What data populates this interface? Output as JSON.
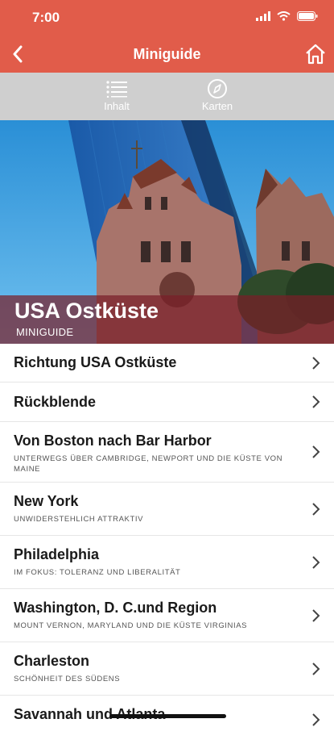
{
  "status": {
    "time": "7:00"
  },
  "nav": {
    "title": "Miniguide"
  },
  "toolbar": {
    "items": [
      {
        "label": "Inhalt",
        "icon": "list-icon"
      },
      {
        "label": "Karten",
        "icon": "compass-icon"
      }
    ]
  },
  "hero": {
    "title": "USA Ostküste",
    "subtitle": "MINIGUIDE"
  },
  "list": [
    {
      "title": "Richtung USA Ostküste",
      "subtitle": ""
    },
    {
      "title": "Rückblende",
      "subtitle": ""
    },
    {
      "title": "Von Boston nach Bar Harbor",
      "subtitle": "UNTERWEGS ÜBER CAMBRIDGE, NEWPORT UND DIE KÜSTE VON MAINE"
    },
    {
      "title": "New York",
      "subtitle": "UNWIDERSTEHLICH ATTRAKTIV"
    },
    {
      "title": "Philadelphia",
      "subtitle": "IM FOKUS: TOLERANZ UND LIBERALITÄT"
    },
    {
      "title": "Washington, D. C.und Region",
      "subtitle": "MOUNT VERNON, MARYLAND UND DIE KÜSTE VIRGINIAS"
    },
    {
      "title": "Charleston",
      "subtitle": "SCHÖNHEIT DES SÜDENS"
    },
    {
      "title": "Savannah und Atlanta",
      "subtitle": ""
    }
  ],
  "colors": {
    "accent": "#e15c4a",
    "toolbar": "#cfcfcf",
    "banner": "#781e28"
  }
}
